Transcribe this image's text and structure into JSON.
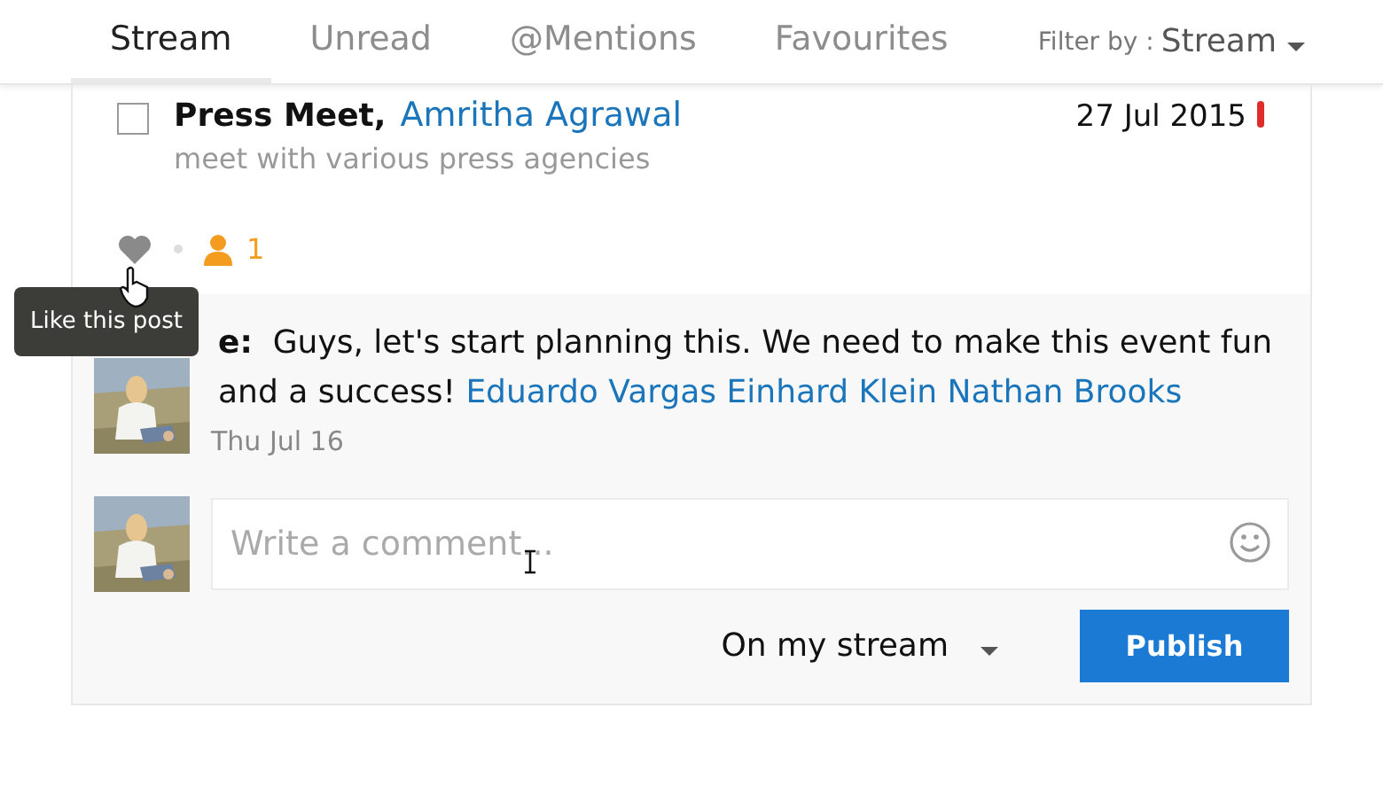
{
  "tabs": [
    {
      "label": "Stream",
      "selected": true
    },
    {
      "label": "Unread",
      "selected": false
    },
    {
      "label": "@Mentions",
      "selected": false
    },
    {
      "label": "Favourites",
      "selected": false
    }
  ],
  "filter": {
    "label": "Filter by :",
    "value": "Stream"
  },
  "post": {
    "checked": false,
    "title": "Press Meet,",
    "author": "Amritha Agrawal",
    "date": "27 Jul 2015",
    "important": true,
    "description": "meet with various press agencies",
    "liked": false,
    "participants": "1"
  },
  "tooltip": "Like this post",
  "comment": {
    "author": "e:",
    "text": "Guys, let's start planning this. We need to make this event fun and a success!",
    "mentions": [
      "Eduardo Vargas",
      "Einhard Klein",
      "Nathan Brooks"
    ],
    "time": "Thu Jul 16"
  },
  "composer": {
    "placeholder": "Write a comment...",
    "audience": "On my stream",
    "publish": "Publish"
  }
}
